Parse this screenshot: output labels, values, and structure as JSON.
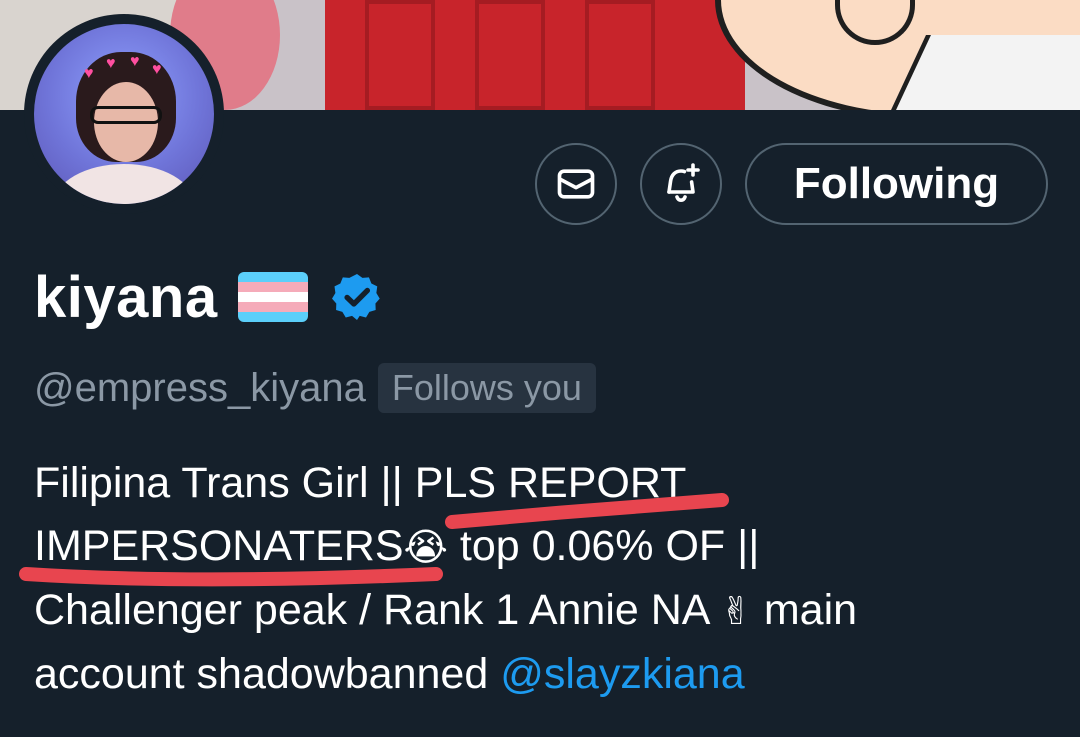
{
  "profile": {
    "display_name": "kiyana",
    "handle": "@empress_kiyana",
    "follows_you_label": "Follows you",
    "flag_icon": "transgender-flag-icon",
    "verified_icon": "verified-badge-icon",
    "bio": {
      "line1": "Filipina Trans Girl || PLS REPORT",
      "line2_text": "IMPERSONATERS",
      "line2_emoji": "😭",
      "line2_rest": " top 0.06% OF ||",
      "line3_text": "Challenger peak / Rank 1 Annie NA ",
      "line3_emoji": "✌",
      "line3_rest": " main",
      "line4_text": "account shadowbanned ",
      "line4_mention": "@slayzkiana"
    }
  },
  "actions": {
    "message_icon": "envelope-icon",
    "notify_icon": "bell-plus-icon",
    "follow_label": "Following"
  },
  "colors": {
    "background": "#15202b",
    "muted_text": "#8b98a5",
    "link": "#1d9bf0",
    "verified": "#1d9bf0",
    "button_border": "#536471",
    "scribble": "#e8454f"
  }
}
